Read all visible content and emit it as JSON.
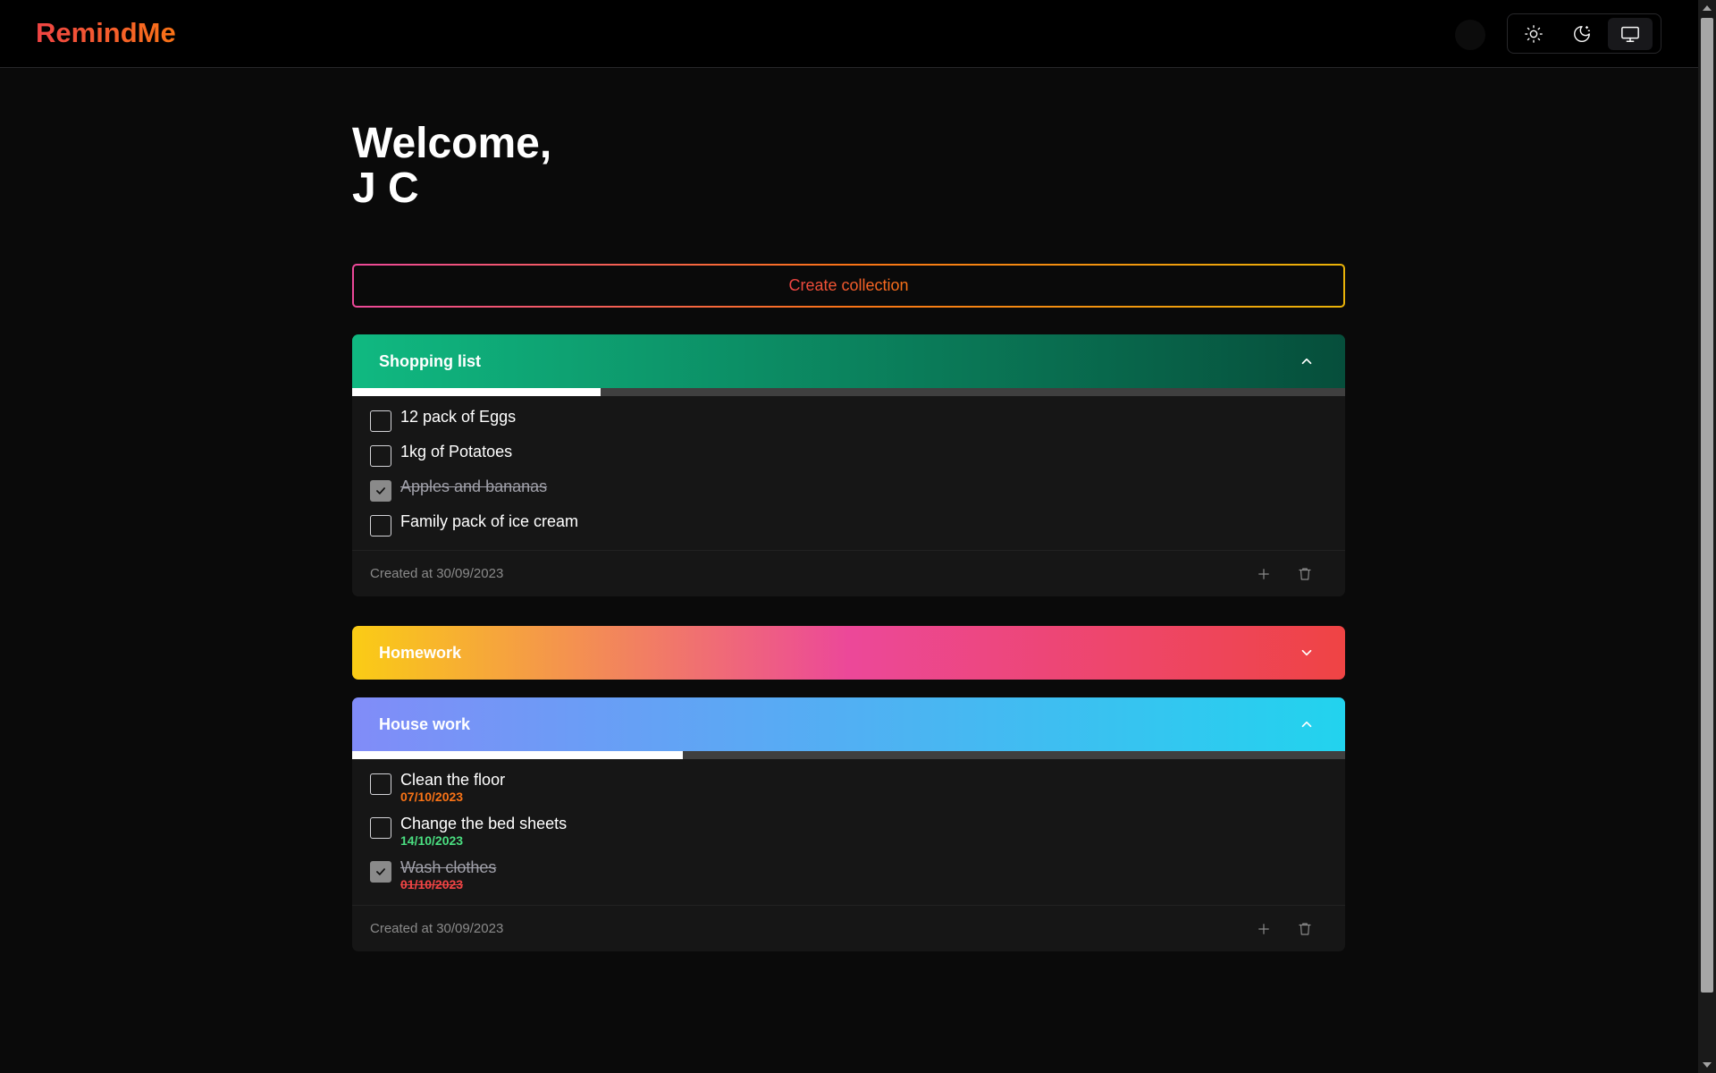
{
  "app": {
    "logo": "RemindMe"
  },
  "theme_switcher": {
    "options": [
      {
        "icon": "sun-icon",
        "active": false
      },
      {
        "icon": "moon-icon",
        "active": false
      },
      {
        "icon": "monitor-icon",
        "active": true
      }
    ]
  },
  "welcome": {
    "line1": "Welcome,",
    "line2": "J C"
  },
  "create_button": {
    "label": "Create collection"
  },
  "collections": [
    {
      "title": "Shopping list",
      "expanded": true,
      "gradient": [
        "#10b981",
        "#064e3b"
      ],
      "progress": 0.25,
      "tasks": [
        {
          "text": "12 pack of Eggs",
          "done": false
        },
        {
          "text": "1kg of Potatoes",
          "done": false
        },
        {
          "text": "Apples and bananas",
          "done": true
        },
        {
          "text": "Family pack of ice cream",
          "done": false
        }
      ],
      "created": "Created at 30/09/2023"
    },
    {
      "title": "Homework",
      "expanded": false,
      "gradient": [
        "#facc15",
        "#ec4899",
        "#ef4444"
      ]
    },
    {
      "title": "House work",
      "expanded": true,
      "gradient": [
        "#818cf8",
        "#22d3ee"
      ],
      "progress": 0.333,
      "tasks": [
        {
          "text": "Clean the floor",
          "date": "07/10/2023",
          "date_color": "#f97316",
          "done": false
        },
        {
          "text": "Change the bed sheets",
          "date": "14/10/2023",
          "date_color": "#4ade80",
          "done": false
        },
        {
          "text": "Wash clothes",
          "date": "01/10/2023",
          "date_color": "#ef4444",
          "done": true
        }
      ],
      "created": "Created at 30/09/2023"
    }
  ]
}
